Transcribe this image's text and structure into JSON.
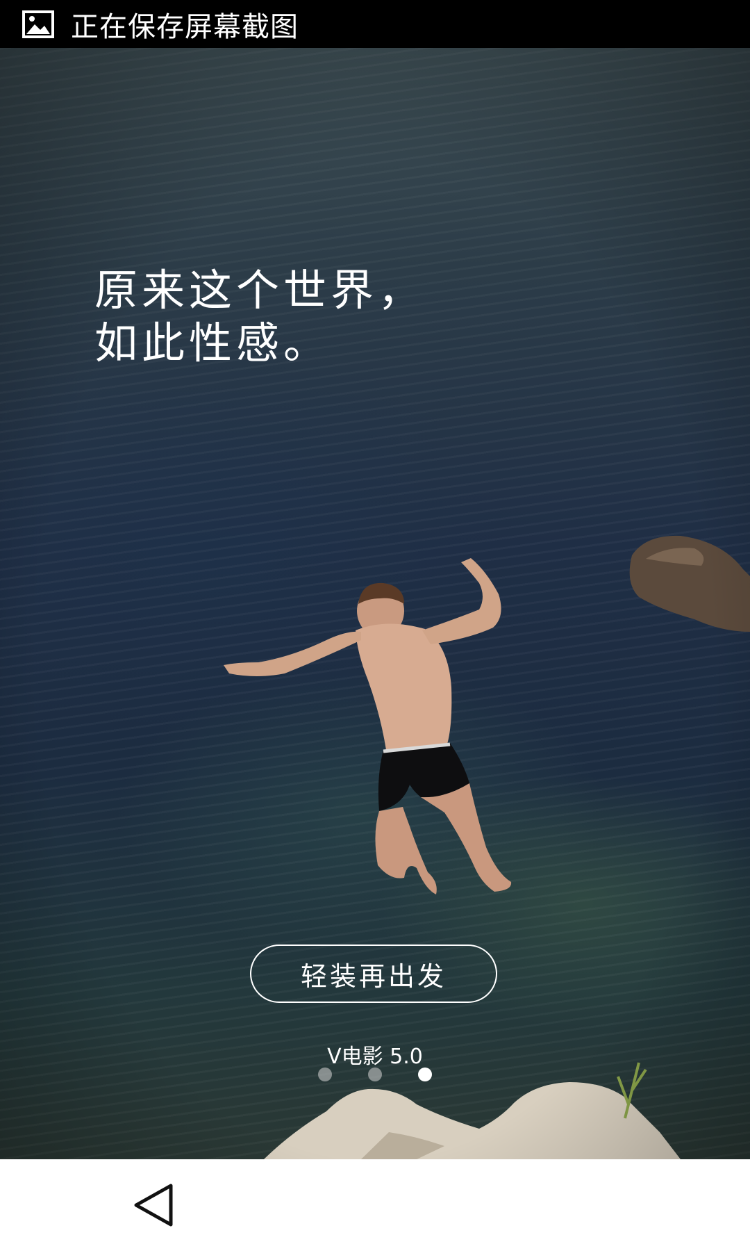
{
  "status_bar": {
    "icon": "image-icon",
    "text": "正在保存屏幕截图"
  },
  "headline": {
    "line1": "原来这个世界，",
    "line2": "如此性感。"
  },
  "cta": {
    "label": "轻装再出发"
  },
  "version": {
    "label": "V电影 5.0"
  },
  "pager": {
    "total": 3,
    "active_index": 3
  },
  "nav_bar": {
    "back_icon": "back-triangle-icon"
  },
  "colors": {
    "status_bar_bg": "#000000",
    "text": "#ffffff",
    "nav_bar_bg": "#ffffff",
    "sea_dark": "#1c2c40"
  }
}
